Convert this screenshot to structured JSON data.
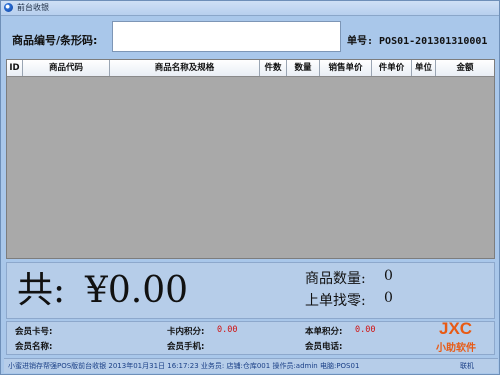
{
  "window": {
    "title": "前台收银"
  },
  "search": {
    "label": "商品编号/条形码:",
    "value": "",
    "order_no": "单号: POS01-201301310001"
  },
  "table": {
    "columns": [
      "ID",
      "商品代码",
      "商品名称及规格",
      "件数",
      "数量",
      "销售单价",
      "件单价",
      "单位",
      "金额"
    ],
    "rows": []
  },
  "totals": {
    "prefix": "共:",
    "amount": "¥0.00",
    "qty_label": "商品数量:",
    "qty_value": "0",
    "change_label": "上单找零:",
    "change_value": "0"
  },
  "member": {
    "card_label": "会员卡号:",
    "card_value": "",
    "points_label": "卡内积分:",
    "points_value": "0.00",
    "this_points_label": "本单积分:",
    "this_points_value": "0.00",
    "name_label": "会员名称:",
    "name_value": "",
    "phone_label": "会员手机:",
    "phone_value": "",
    "tel_label": "会员电话:",
    "tel_value": ""
  },
  "status_bar": {
    "text": "小蜜进销存帮强POS版前台收银   2013年01月31日   16:17:23   业务员:    店铺:仓库001   操作员:admin   电脑:POS01",
    "link": "联机"
  },
  "watermark": {
    "brand": "JXC",
    "sub": "小助软件"
  },
  "colors": {
    "background": "#a9c7ea",
    "table_bg": "#a9a9a9",
    "red_value": "#d01010",
    "watermark": "#e85a14"
  }
}
